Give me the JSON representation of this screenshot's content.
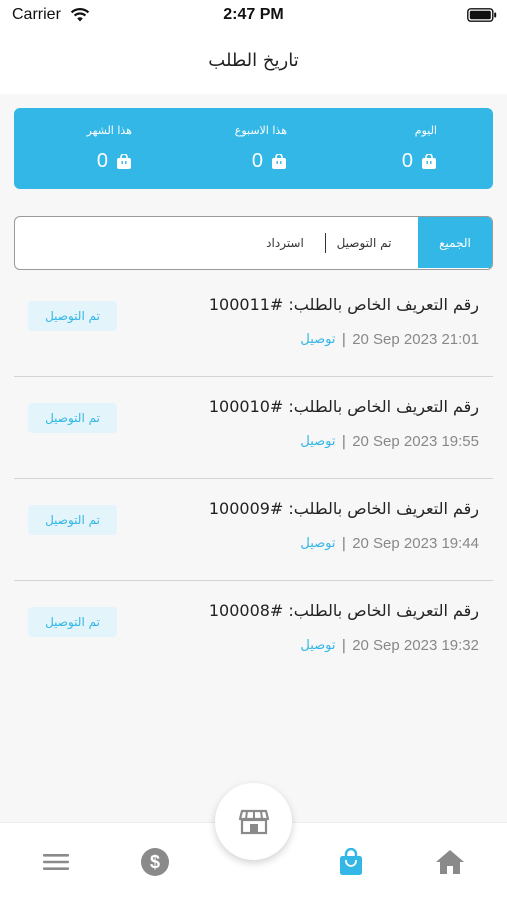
{
  "status_bar": {
    "carrier": "Carrier",
    "time": "2:47 PM"
  },
  "header": {
    "title": "تاريخ الطلب"
  },
  "stats": {
    "today_label": "اليوم",
    "today_value": "0",
    "week_label": "هذا الاسبوع",
    "week_value": "0",
    "month_label": "هذا الشهر",
    "month_value": "0"
  },
  "filters": {
    "all": "الجميع",
    "delivered": "تم التوصيل",
    "refund": "استرداد"
  },
  "orders": [
    {
      "title": "رقم التعريف الخاص بالطلب: #100011",
      "date": "20 Sep 2023  21:01",
      "type": "توصيل",
      "status": "تم التوصيل"
    },
    {
      "title": "رقم التعريف الخاص بالطلب: #100010",
      "date": "20 Sep 2023  19:55",
      "type": "توصيل",
      "status": "تم التوصيل"
    },
    {
      "title": "رقم التعريف الخاص بالطلب: #100009",
      "date": "20 Sep 2023  19:44",
      "type": "توصيل",
      "status": "تم التوصيل"
    },
    {
      "title": "رقم التعريف الخاص بالطلب: #100008",
      "date": "20 Sep 2023  19:32",
      "type": "توصيل",
      "status": "تم التوصيل"
    }
  ],
  "colors": {
    "accent": "#33b7e6",
    "icon_gray": "#8a8a8a"
  },
  "nav_icons": [
    "menu-icon",
    "dollar-icon",
    "store-icon",
    "shopping-bag-icon",
    "home-icon"
  ]
}
